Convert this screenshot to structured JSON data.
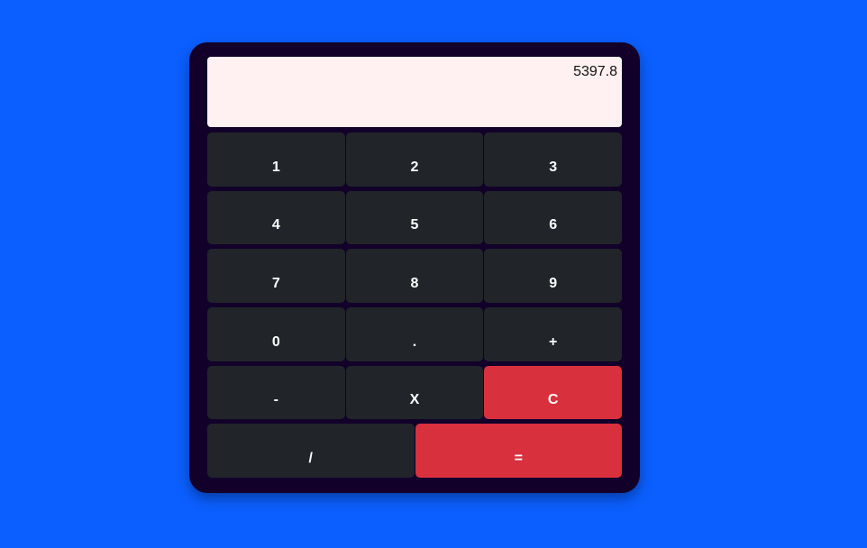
{
  "display": {
    "value": "5397.8"
  },
  "colors": {
    "background": "#0b5ffe",
    "calculator_body": "#12002a",
    "display_bg": "#fff0f1",
    "key": "#212529",
    "key_danger": "#d9303e"
  },
  "keys": {
    "one": "1",
    "two": "2",
    "three": "3",
    "four": "4",
    "five": "5",
    "six": "6",
    "seven": "7",
    "eight": "8",
    "nine": "9",
    "zero": "0",
    "decimal": ".",
    "plus": "+",
    "minus": "-",
    "multiply": "X",
    "clear": "C",
    "divide": "/",
    "equals": "="
  }
}
